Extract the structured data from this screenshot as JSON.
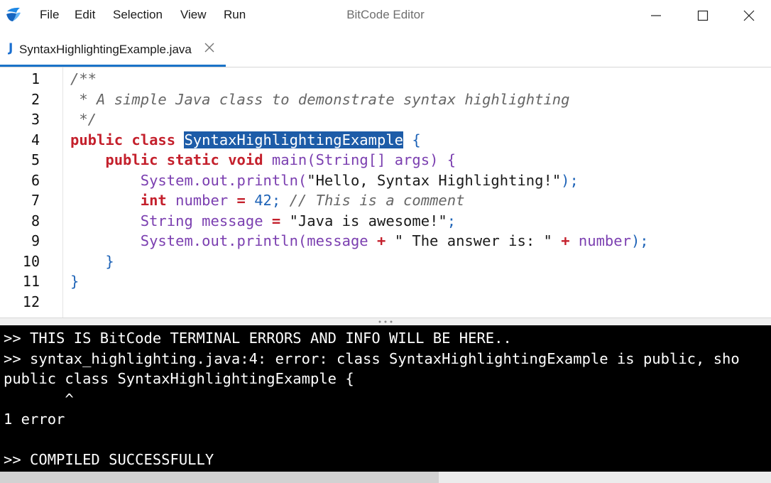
{
  "app": {
    "title": "BitCode Editor",
    "menu": [
      "File",
      "Edit",
      "Selection",
      "View",
      "Run"
    ]
  },
  "tab": {
    "icon": "J",
    "label": "SyntaxHighlightingExample.java"
  },
  "editor": {
    "line_numbers": [
      "1",
      "2",
      "3",
      "4",
      "5",
      "6",
      "7",
      "8",
      "9",
      "10",
      "11",
      "12"
    ],
    "lines": {
      "l1": "/**",
      "l2": " * A simple Java class to demonstrate syntax highlighting",
      "l3": " */",
      "l4_kw1": "public",
      "l4_kw2": "class",
      "l4_sel": "SyntaxHighlightingExample",
      "l4_brace": "{",
      "l5_kw1": "public",
      "l5_kw2": "static",
      "l5_kw3": "void",
      "l5_rest": "main(String[] args) {",
      "l6_call": "System.out.println(",
      "l6_str": "\"Hello, Syntax Highlighting!\"",
      "l6_end": ");",
      "l7_kw": "int",
      "l7_var": "number",
      "l7_eq": "=",
      "l7_num": "42",
      "l7_semi": ";",
      "l7_cmt": "// This is a comment",
      "l8_type": "String",
      "l8_var": "message",
      "l8_eq": "=",
      "l8_str": "\"Java is awesome!\"",
      "l8_semi": ";",
      "l9_call": "System.out.println(message",
      "l9_plus1": "+",
      "l9_str": "\" The answer is: \"",
      "l9_plus2": "+",
      "l9_var": "number",
      "l9_end": ");",
      "l10": "}",
      "l11": "}"
    }
  },
  "terminal": {
    "lines": [
      ">> THIS IS BitCode TERMINAL ERRORS AND INFO WILL BE HERE..",
      ">> syntax_highlighting.java:4: error: class SyntaxHighlightingExample is public, sho",
      "public class SyntaxHighlightingExample {",
      "       ^",
      "1 error",
      "",
      ">> COMPILED SUCCESSFULLY"
    ]
  },
  "colors": {
    "keyword": "#c4202c",
    "identifier": "#7b3fb0",
    "punctuation": "#1e63b7",
    "selection": "#1d5ca8",
    "tab_accent": "#1a73c8",
    "terminal_bg": "#000000"
  }
}
